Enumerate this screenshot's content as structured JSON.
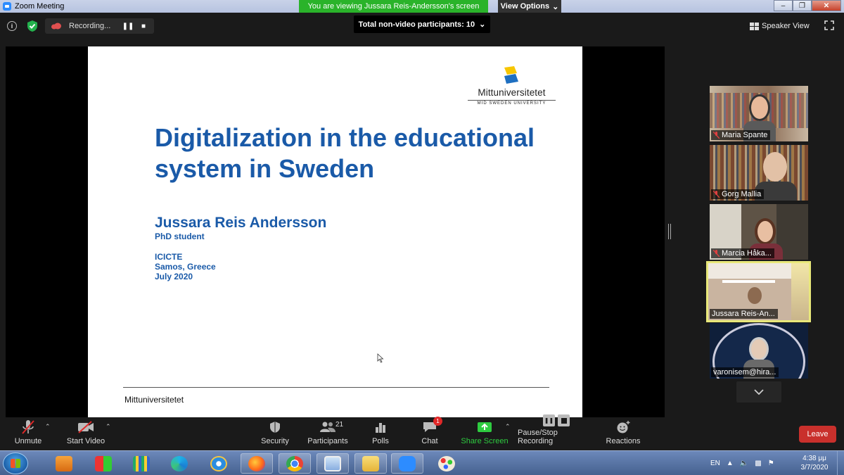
{
  "window": {
    "title": "Zoom Meeting",
    "viewing_banner": "You are viewing Jussara Reis-Andersson's screen",
    "view_options": "View Options"
  },
  "topbar": {
    "recording_label": "Recording...",
    "nonvideo_label": "Total non-video participants: 10",
    "speaker_view": "Speaker View"
  },
  "slide": {
    "logo_name": "Mittuniversitetet",
    "logo_sub": "MID SWEDEN UNIVERSITY",
    "title_line1": "Digitalization in the educational",
    "title_line2": "system in Sweden",
    "author": "Jussara Reis Andersson",
    "role": "PhD student",
    "conf1": "ICICTE",
    "conf2": "Samos, Greece",
    "conf3": "July 2020",
    "footer": "Mittuniversitetet"
  },
  "participants": [
    {
      "name": "Maria Spante"
    },
    {
      "name": "Gorg Mallia"
    },
    {
      "name": "Marcia Håka..."
    },
    {
      "name": "Jussara Reis-An..."
    },
    {
      "name": "varonisem@hira..."
    }
  ],
  "toolbar": {
    "unmute": "Unmute",
    "start_video": "Start Video",
    "security": "Security",
    "participants": "Participants",
    "participants_count": "21",
    "polls": "Polls",
    "chat": "Chat",
    "chat_badge": "1",
    "share_screen": "Share Screen",
    "recording": "Pause/Stop Recording",
    "reactions": "Reactions",
    "leave": "Leave"
  },
  "taskbar": {
    "lang": "EN",
    "time": "4:38 μμ",
    "date": "3/7/2020"
  },
  "colors": {
    "slide_blue": "#1a5aa8",
    "banner_green": "#2ab32a",
    "leave_red": "#c9302c",
    "active_speaker": "#e8e87a"
  }
}
